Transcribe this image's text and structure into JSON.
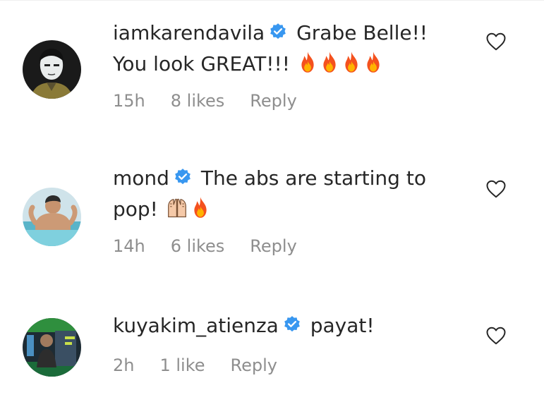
{
  "comments": [
    {
      "username": "iamkarendavila",
      "verified": true,
      "text": "Grabe Belle!! You look GREAT!!!",
      "emojis": [
        "fire-icon",
        "fire-icon",
        "fire-icon",
        "fire-icon"
      ],
      "time": "15h",
      "likes": "8 likes",
      "reply_label": "Reply"
    },
    {
      "username": "mond",
      "verified": true,
      "text": "The abs are starting to pop!",
      "emojis": [
        "raising-hands-icon",
        "fire-icon"
      ],
      "time": "14h",
      "likes": "6 likes",
      "reply_label": "Reply"
    },
    {
      "username": "kuyakim_atienza",
      "verified": true,
      "text": "payat!",
      "emojis": [],
      "time": "2h",
      "likes": "1 like",
      "reply_label": "Reply"
    }
  ],
  "colors": {
    "text": "#262626",
    "muted": "#8e8e8e",
    "verified": "#3897f0",
    "fire_outer": "#f4511e",
    "fire_inner": "#ffb300"
  }
}
